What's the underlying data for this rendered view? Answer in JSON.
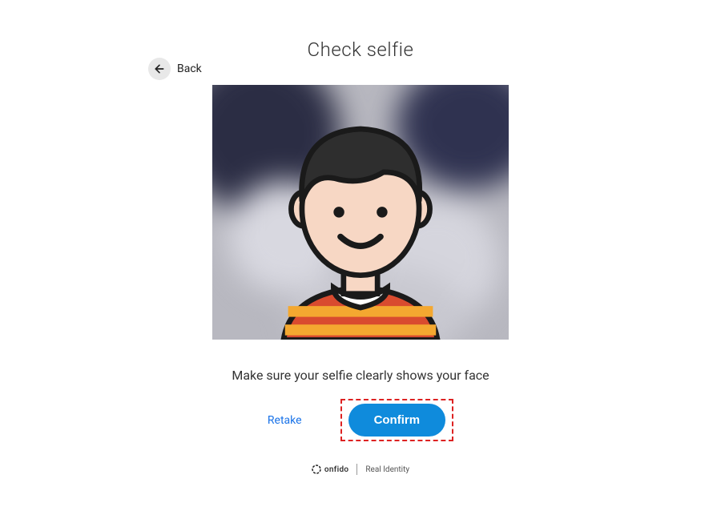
{
  "back_label": "Back",
  "title": "Check selfie",
  "instruction": "Make sure your selfie clearly shows your face",
  "retake_label": "Retake",
  "confirm_label": "Confirm",
  "footer_brand": "onfido",
  "footer_tagline": "Real Identity"
}
